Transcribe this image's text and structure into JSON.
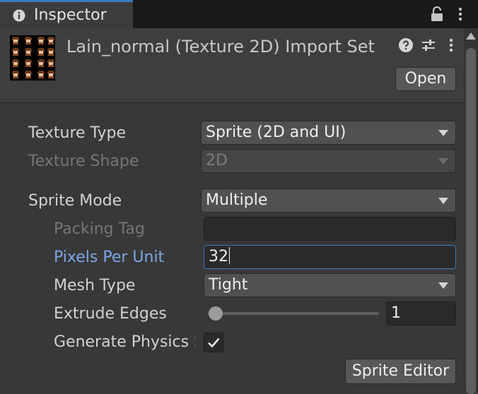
{
  "tab": {
    "title": "Inspector"
  },
  "header": {
    "title": "Lain_normal (Texture 2D) Import Set",
    "open_label": "Open"
  },
  "properties": {
    "texture_type": {
      "label": "Texture Type",
      "value": "Sprite (2D and UI)"
    },
    "texture_shape": {
      "label": "Texture Shape",
      "value": "2D"
    },
    "sprite_mode": {
      "label": "Sprite Mode",
      "value": "Multiple"
    },
    "packing_tag": {
      "label": "Packing Tag",
      "value": ""
    },
    "pixels_per_unit": {
      "label": "Pixels Per Unit",
      "value": "32"
    },
    "mesh_type": {
      "label": "Mesh Type",
      "value": "Tight"
    },
    "extrude_edges": {
      "label": "Extrude Edges",
      "value": "1",
      "slider_fraction": 0.03
    },
    "generate_physics": {
      "label": "Generate Physics Shape",
      "checked": true
    }
  },
  "buttons": {
    "sprite_editor": "Sprite Editor"
  },
  "colors": {
    "accent": "#3a79bb",
    "active_label": "#7ba7e6",
    "background": "#383838"
  },
  "icons": [
    "info-icon",
    "lock-icon",
    "kebab-menu-icon",
    "help-icon",
    "presets-icon",
    "chevron-down-icon",
    "checkmark-icon"
  ]
}
